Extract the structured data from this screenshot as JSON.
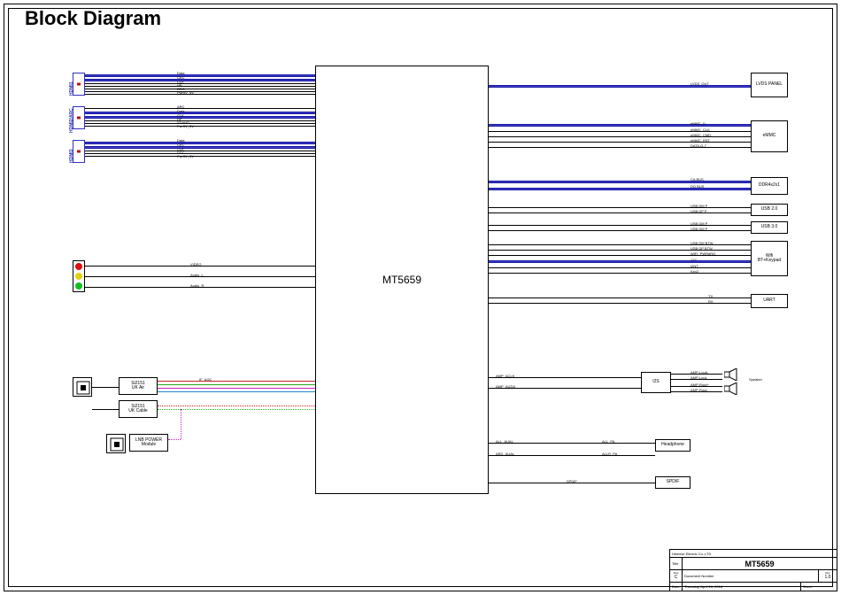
{
  "title": "Block Diagram",
  "chip": {
    "label": "MT5659"
  },
  "left_ports": {
    "hdmi1": {
      "label": "HDMI1",
      "signals": [
        "Data",
        "CEC",
        "CLK",
        "HP",
        "DDC",
        "Pwr5V_5V"
      ]
    },
    "hdmi2": {
      "label": "HDMI2/ARC",
      "signals": [
        "ARC",
        "Data",
        "CLK",
        "HP",
        "SDAHD",
        "Pwr5V_5V"
      ]
    },
    "hdmi3": {
      "label": "HDMI3",
      "signals": [
        "Data",
        "CEC",
        "CLK",
        "DDC",
        "Pwr5V_5V"
      ]
    }
  },
  "av": {
    "video": "VIDEO",
    "audio_l": "Audio_L",
    "audio_r": "Audio_R"
  },
  "tuner": {
    "block1": {
      "line1": "Si2151",
      "line2": "UK Air"
    },
    "block2": {
      "line1": "Si2151",
      "line2": "UK Cable"
    },
    "block3": {
      "line1": "LNB POWER",
      "line2": "Module"
    },
    "bus": "IF_AGC"
  },
  "right": {
    "lvds_panel": {
      "box": "LVDS PANEL",
      "sig": "LVDS_OUT"
    },
    "emmc": {
      "box": "eMMC",
      "sigs": [
        "eMMC_D",
        "eMMC_CLK",
        "eMMC_CMD",
        "eMMC_RST",
        "DATA-D-7"
      ]
    },
    "ddr": {
      "box": "DDR4x2x1",
      "sigs": [
        "CA BUS",
        "DQ BUS"
      ]
    },
    "usb": {
      "box1": "USB 2.0",
      "box2": "USB 3.0",
      "sigs": [
        "USB DM P",
        "USB DP P",
        "USB DM P",
        "USB DM P"
      ]
    },
    "wifi": {
      "box": "Wifi\nBT+Keypad",
      "sigs": [
        "USB DM BTW",
        "USB DP BTW",
        "WIFI_PWR#RQ",
        "12C",
        "I2NT",
        "Key2"
      ]
    },
    "uart": {
      "box": "UART",
      "sigs": [
        "TX",
        "RX"
      ]
    },
    "amp": {
      "box": "I2S",
      "in": [
        "AMP_ACLK",
        "AMP_AUDA"
      ],
      "out": [
        "AMP-LoutL",
        "AMP-Lout-",
        "AMP-Rout+",
        "AMP-Rout-"
      ],
      "speaker": "Speaker"
    },
    "hp": {
      "box": "Headphone",
      "sigs": [
        "ALL_AUAL",
        "ALL_PA",
        "ARD_AUAL",
        "ALLR_PA"
      ]
    },
    "spdif": {
      "box": "SPDIF",
      "sig": "SPDIF"
    }
  },
  "title_block": {
    "company": "Hisense Electric Co.,LTD",
    "title_label": "Title",
    "size_label": "Size",
    "size": "C",
    "doc_label": "Document Number",
    "rev_label": "Rev",
    "rev": "1.0",
    "date_label": "Date:",
    "date": "Thursday, April 26, 2018",
    "sheet_label": "Sheet",
    "main": "MT5659"
  }
}
